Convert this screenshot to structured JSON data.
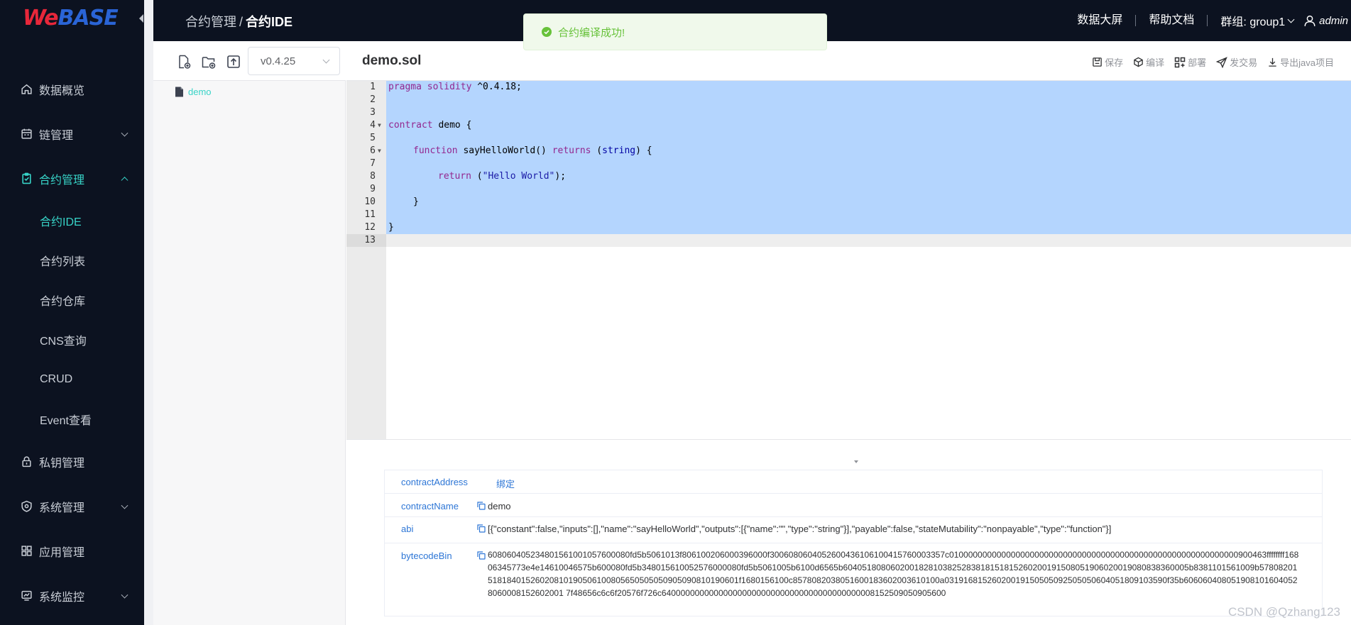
{
  "logo": {
    "we": "We",
    "base": "BASE"
  },
  "sidebar": {
    "items": [
      {
        "label": "数据概览",
        "icon": "home-icon"
      },
      {
        "label": "链管理",
        "icon": "calendar-icon"
      },
      {
        "label": "合约管理",
        "icon": "clipboard-icon"
      },
      {
        "label": "私钥管理",
        "icon": "lock-icon"
      },
      {
        "label": "系统管理",
        "icon": "shield-icon"
      },
      {
        "label": "应用管理",
        "icon": "grid-icon"
      },
      {
        "label": "系统监控",
        "icon": "monitor-icon"
      }
    ],
    "submenu": [
      {
        "label": "合约IDE"
      },
      {
        "label": "合约列表"
      },
      {
        "label": "合约仓库"
      },
      {
        "label": "CNS查询"
      },
      {
        "label": "CRUD"
      },
      {
        "label": "Event查看"
      }
    ]
  },
  "breadcrumb": {
    "parent": "合约管理",
    "separator": "/",
    "current": "合约IDE"
  },
  "header": {
    "dashboard": "数据大屏",
    "help": "帮助文档",
    "group": "群组: group1",
    "user": "admin"
  },
  "toast": {
    "message": "合约编译成功!"
  },
  "files": {
    "version": "v0.4.25",
    "items": [
      {
        "name": "demo"
      }
    ]
  },
  "editor": {
    "filename": "demo.sol",
    "actions": {
      "save": "保存",
      "compile": "编译",
      "deploy": "部署",
      "send": "发交易",
      "export": "导出java项目"
    },
    "lines": [
      "1",
      "2",
      "3",
      "4",
      "5",
      "6",
      "7",
      "8",
      "9",
      "10",
      "11",
      "12",
      "13"
    ],
    "code": {
      "l1_kw": "pragma solidity",
      "l1_rest": " ^0.4.18;",
      "l4_kw": "contract",
      "l4_rest": " demo {",
      "l6_kw": "function",
      "l6_name": " sayHelloWorld() ",
      "l6_kw2": "returns",
      "l6_open": " (",
      "l6_type": "string",
      "l6_close": ") {",
      "l8_kw": "return",
      "l8_open": " (",
      "l8_str": "\"Hello World\"",
      "l8_close": ");",
      "l10": "}",
      "l12": "}"
    }
  },
  "result": {
    "address_key": "contractAddress",
    "bind_label": "绑定",
    "name_key": "contractName",
    "name_val": "demo",
    "abi_key": "abi",
    "abi_val": "[{\"constant\":false,\"inputs\":[],\"name\":\"sayHelloWorld\",\"outputs\":[{\"name\":\"\",\"type\":\"string\"}],\"payable\":false,\"stateMutability\":\"nonpayable\",\"type\":\"function\"}]",
    "bytecode_key": "bytecodeBin",
    "bytecode_val": "608060405234801561001057600080fd5b5061013f806100206000396000f3006080604052600436106100415760003357c0100000000000000000000000000000000000000000000000000000000000900463ffffffff16806345773e4e14610046575b600080fd5b348015610052576000080fd5b5061005b6100d6565b6040518080602001828103825283818151815260200191508051906020019080838360005b8381101561009b5780820151818401526020810190506100805650505050905090810190601f1680156100c8578082038051600183602003610100a03191681526020019150505092505050604051809103590f35b6060604080519081016040528060008152602001 7f48656c6c6f20576f726c640000000000000000000000000000000000000000008152509050905600"
  },
  "watermark": "CSDN @Qzhang123",
  "colors": {
    "accent": "#37d3c7",
    "sidebar_bg": "#0c1220",
    "selection": "#b4d5fe",
    "link": "#2d76d6",
    "success": "#67c23a"
  }
}
